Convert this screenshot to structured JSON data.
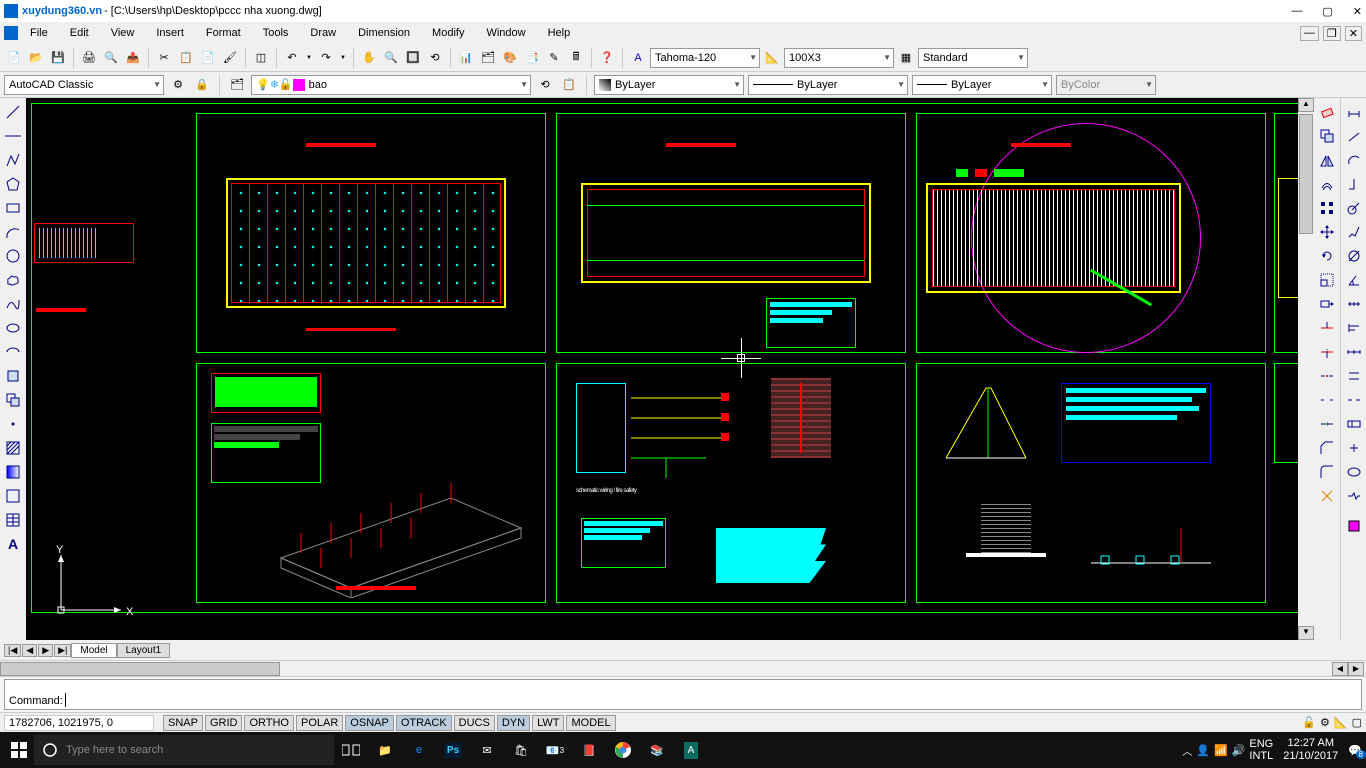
{
  "title_app": "xuydung360.vn",
  "title_file": "- [C:\\Users\\hp\\Desktop\\pccc nha xuong.dwg]",
  "menus": [
    "File",
    "Edit",
    "View",
    "Insert",
    "Format",
    "Tools",
    "Draw",
    "Dimension",
    "Modify",
    "Window",
    "Help"
  ],
  "workspace": "AutoCAD Classic",
  "layer_current": "bao",
  "layer_color": "#ff00ff",
  "textstyle": "Tahoma-120",
  "dimstyle": "100X3",
  "tablestyle": "Standard",
  "prop_color": "ByLayer",
  "prop_ltype": "ByLayer",
  "prop_lweight": "ByLayer",
  "prop_plotstyle": "ByColor",
  "tabs": {
    "model": "Model",
    "layout": "Layout1"
  },
  "command_prompt": "Command: ",
  "coords": "1782706, 1021975, 0",
  "status_buttons": [
    "SNAP",
    "GRID",
    "ORTHO",
    "POLAR",
    "OSNAP",
    "OTRACK",
    "DUCS",
    "DYN",
    "LWT",
    "MODEL"
  ],
  "status_on": [
    4,
    5,
    7
  ],
  "taskbar": {
    "search_placeholder": "Type here to search",
    "lang1": "ENG",
    "lang2": "INTL",
    "time": "12:27 AM",
    "date": "21/10/2017",
    "notif": "8"
  },
  "ucs": {
    "x": "X",
    "y": "Y"
  },
  "colors": {
    "title": "#0066cc",
    "canvas": "#000000",
    "frame": "#00ff00",
    "layer_swatch": "#ff00ff"
  }
}
